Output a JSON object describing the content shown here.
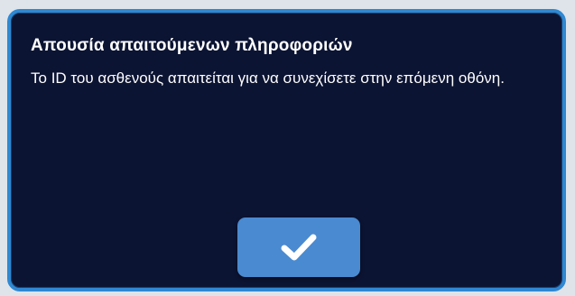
{
  "dialog": {
    "title": "Απουσία απαιτούμενων πληροφοριών",
    "message": "Το ID του ασθενούς απαιτείται για να συνεχίσετε στην επόμενη οθόνη.",
    "confirm_icon": "checkmark-icon"
  },
  "colors": {
    "dialog_background": "#0c1433",
    "dialog_border": "#2f88d2",
    "button_background": "#4a8ad0",
    "text": "#ffffff"
  }
}
